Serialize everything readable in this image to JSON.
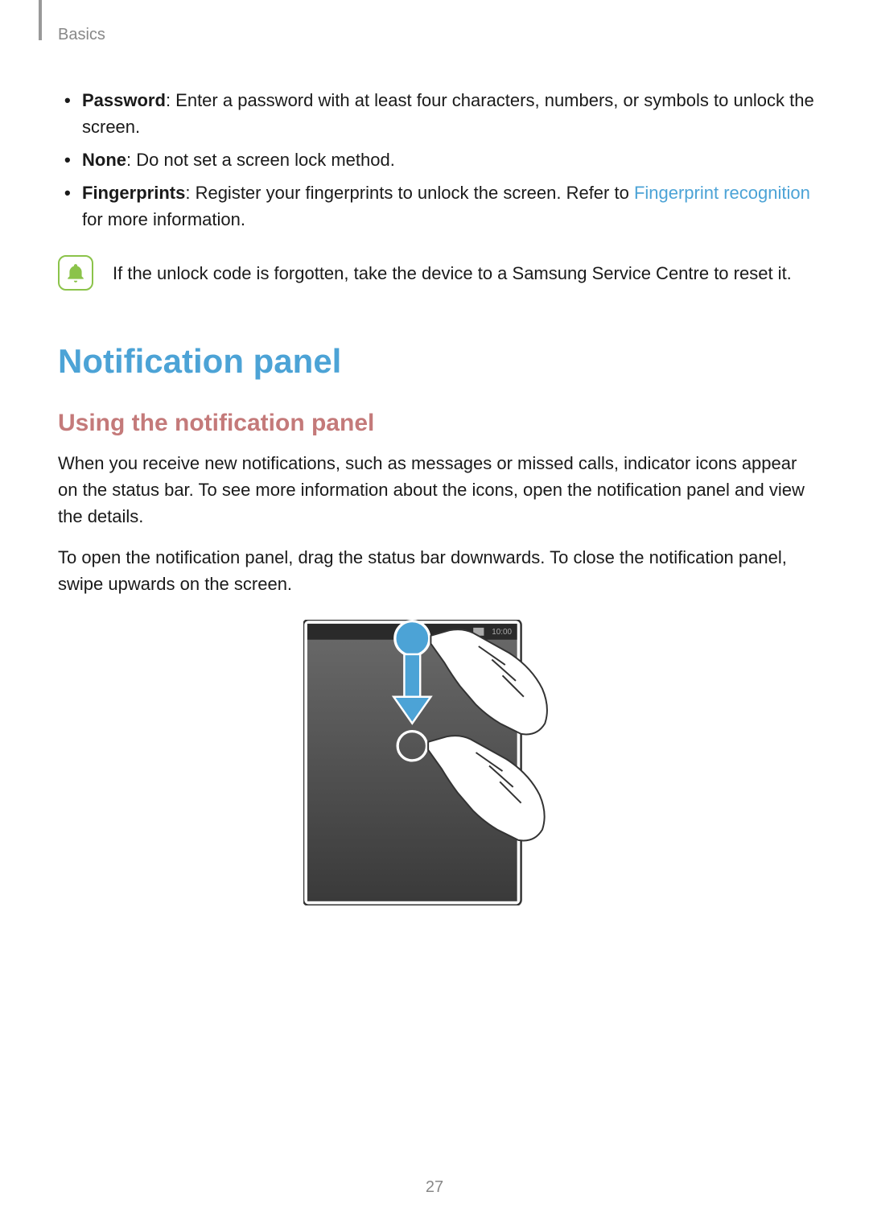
{
  "breadcrumb": "Basics",
  "bullets": [
    {
      "label": "Password",
      "text": ": Enter a password with at least four characters, numbers, or symbols to unlock the screen."
    },
    {
      "label": "None",
      "text": ": Do not set a screen lock method."
    },
    {
      "label": "Fingerprints",
      "text_before_link": ": Register your fingerprints to unlock the screen. Refer to ",
      "link": "Fingerprint recognition",
      "text_after_link": " for more information."
    }
  ],
  "note": {
    "text": "If the unlock code is forgotten, take the device to a Samsung Service Centre to reset it."
  },
  "section_heading": "Notification panel",
  "subsection_heading": "Using the notification panel",
  "paragraphs": [
    "When you receive new notifications, such as messages or missed calls, indicator icons appear on the status bar. To see more information about the icons, open the notification panel and view the details.",
    "To open the notification panel, drag the status bar downwards. To close the notification panel, swipe upwards on the screen."
  ],
  "illustration": {
    "status_time": "10:00"
  },
  "page_number": "27"
}
